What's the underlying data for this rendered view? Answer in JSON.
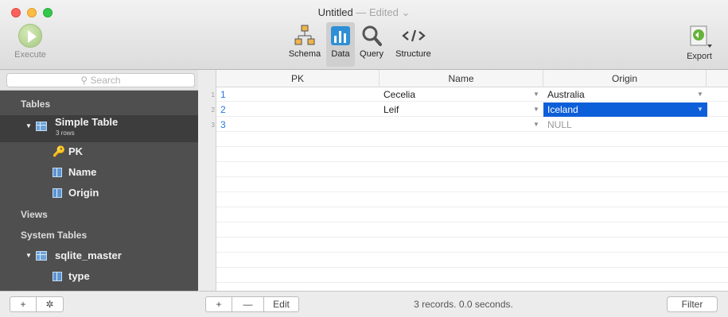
{
  "window": {
    "title": "Untitled",
    "edited": "— Edited",
    "chevron": "⌄"
  },
  "toolbar": {
    "execute_label": "Execute",
    "segments": [
      {
        "label": "Schema",
        "icon": "schema-icon"
      },
      {
        "label": "Data",
        "icon": "data-icon",
        "active": true
      },
      {
        "label": "Query",
        "icon": "query-icon"
      },
      {
        "label": "Structure",
        "icon": "structure-icon"
      }
    ],
    "export_label": "Export"
  },
  "sidebar": {
    "search_placeholder": "Search",
    "section_tables": "Tables",
    "table_name": "Simple Table",
    "table_rows": "3 rows",
    "columns": [
      "PK",
      "Name",
      "Origin"
    ],
    "section_views": "Views",
    "section_system": "System Tables",
    "system_table": "sqlite_master",
    "system_column": "type",
    "add_label": "+",
    "gear_label": "✲"
  },
  "grid": {
    "headers": [
      "PK",
      "Name",
      "Origin"
    ],
    "rows": [
      {
        "num": "1",
        "pk": "1",
        "name": "Cecelia",
        "origin": "Australia"
      },
      {
        "num": "2",
        "pk": "2",
        "name": "Leif",
        "origin": "Iceland"
      },
      {
        "num": "3",
        "pk": "3",
        "name": "",
        "origin": "NULL"
      }
    ]
  },
  "footer": {
    "add_label": "+",
    "remove_label": "—",
    "edit_label": "Edit",
    "status": "3 records. 0.0 seconds.",
    "filter_label": "Filter"
  },
  "colors": {
    "selection": "#0d5fd9",
    "pk_blue": "#2778d8",
    "sidebar_bg": "#4f4f4f"
  }
}
